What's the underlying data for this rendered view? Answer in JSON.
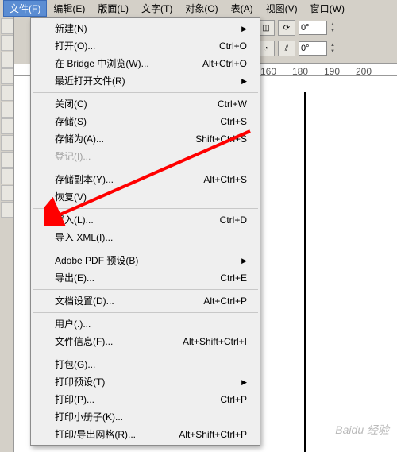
{
  "menubar": {
    "items": [
      {
        "label": "文件(F)",
        "active": true
      },
      {
        "label": "编辑(E)"
      },
      {
        "label": "版面(L)"
      },
      {
        "label": "文字(T)"
      },
      {
        "label": "对象(O)"
      },
      {
        "label": "表(A)"
      },
      {
        "label": "视图(V)"
      },
      {
        "label": "窗口(W)"
      }
    ]
  },
  "toolbar": {
    "angle1": "0°",
    "angle2": "0°"
  },
  "ruler": {
    "ticks": [
      "160",
      "180",
      "190",
      "200"
    ]
  },
  "dropdown": {
    "groups": [
      [
        {
          "label": "新建(N)",
          "submenu": true
        },
        {
          "label": "打开(O)...",
          "shortcut": "Ctrl+O"
        },
        {
          "label": "在 Bridge 中浏览(W)...",
          "shortcut": "Alt+Ctrl+O"
        },
        {
          "label": "最近打开文件(R)",
          "submenu": true
        }
      ],
      [
        {
          "label": "关闭(C)",
          "shortcut": "Ctrl+W"
        },
        {
          "label": "存储(S)",
          "shortcut": "Ctrl+S"
        },
        {
          "label": "存储为(A)...",
          "shortcut": "Shift+Ctrl+S"
        },
        {
          "label": "登记(I)...",
          "disabled": true
        }
      ],
      [
        {
          "label": "存储副本(Y)...",
          "shortcut": "Alt+Ctrl+S"
        },
        {
          "label": "恢复(V)"
        }
      ],
      [
        {
          "label": "置入(L)...",
          "shortcut": "Ctrl+D"
        },
        {
          "label": "导入 XML(I)..."
        }
      ],
      [
        {
          "label": "Adobe PDF 预设(B)",
          "submenu": true
        },
        {
          "label": "导出(E)...",
          "shortcut": "Ctrl+E"
        }
      ],
      [
        {
          "label": "文档设置(D)...",
          "shortcut": "Alt+Ctrl+P"
        }
      ],
      [
        {
          "label": "用户(.)..."
        },
        {
          "label": "文件信息(F)...",
          "shortcut": "Alt+Shift+Ctrl+I"
        }
      ],
      [
        {
          "label": "打包(G)..."
        },
        {
          "label": "打印预设(T)",
          "submenu": true
        },
        {
          "label": "打印(P)...",
          "shortcut": "Ctrl+P"
        },
        {
          "label": "打印小册子(K)..."
        },
        {
          "label": "打印/导出网格(R)...",
          "shortcut": "Alt+Shift+Ctrl+P"
        }
      ]
    ]
  },
  "watermark": "Baidu 经验"
}
